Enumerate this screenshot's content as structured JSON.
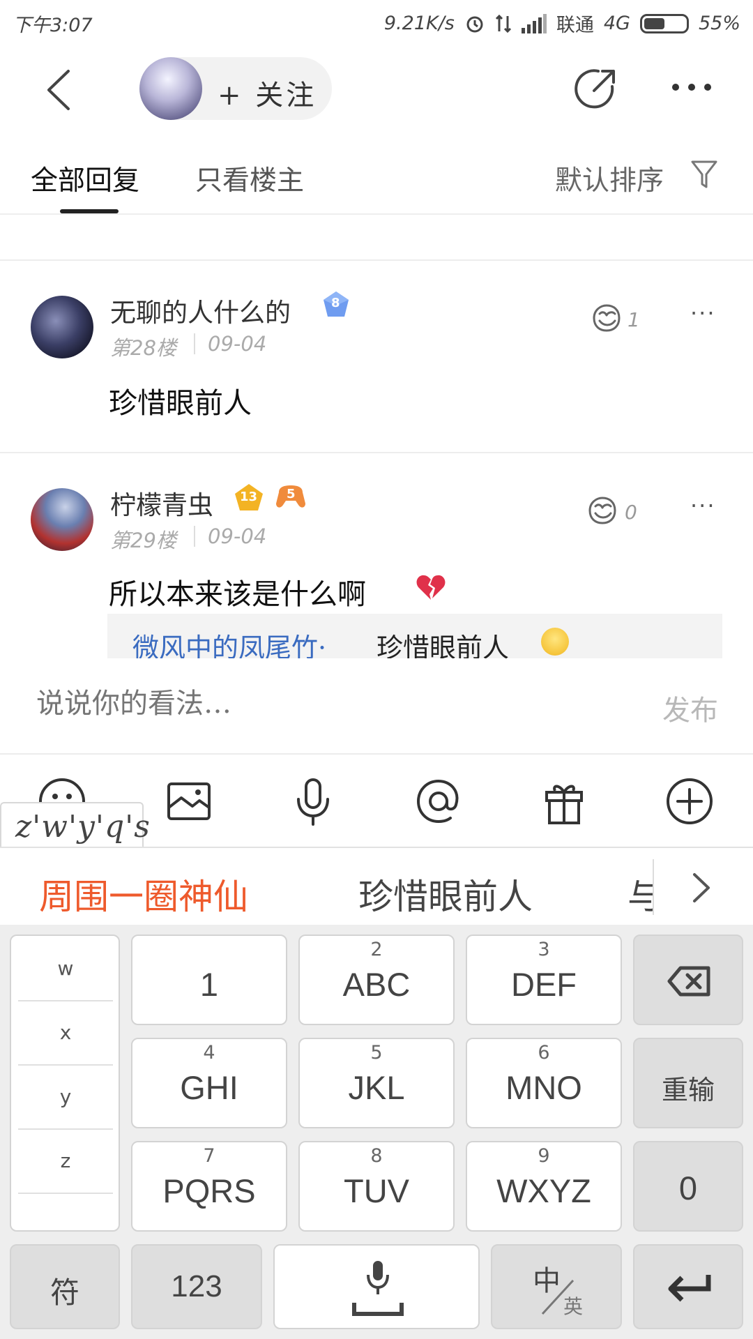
{
  "status_bar": {
    "time": "下午3:07",
    "speed": "9.21K/s",
    "carrier": "联通",
    "network": "4G",
    "battery_percent": "55%",
    "battery_level": 0.55
  },
  "header": {
    "follow_label": "+ 关注"
  },
  "tabs": {
    "all_replies": "全部回复",
    "owner_only": "只看楼主",
    "sort": "默认排序"
  },
  "posts": [
    {
      "username": "无聊的人什么的",
      "level": "8",
      "floor": "第28楼",
      "date": "09-04",
      "content": "珍惜眼前人",
      "likes": "1"
    },
    {
      "username": "柠檬青虫",
      "level": "13",
      "badge2": "5",
      "floor": "第29楼",
      "date": "09-04",
      "content": "所以本来该是什么啊",
      "likes": "0",
      "reply": {
        "name": "微风中的凤尾竹·",
        "text": "珍惜眼前人"
      }
    }
  ],
  "composer": {
    "placeholder": "说说你的看法…",
    "publish": "发布"
  },
  "toolbar": {
    "icons": [
      "emoji-icon",
      "image-icon",
      "microphone-icon",
      "at-icon",
      "gift-icon",
      "plus-icon"
    ]
  },
  "ime": {
    "pinyin": "z'w'y'q's",
    "candidates": [
      "周围一圈神仙",
      "珍惜眼前人",
      "与"
    ],
    "side_letters": [
      "w",
      "x",
      "y",
      "z"
    ],
    "keys": {
      "k1": {
        "num": "",
        "label": "1"
      },
      "k2": {
        "num": "2",
        "label": "ABC"
      },
      "k3": {
        "num": "3",
        "label": "DEF"
      },
      "k4": {
        "num": "4",
        "label": "GHI"
      },
      "k5": {
        "num": "5",
        "label": "JKL"
      },
      "k6": {
        "num": "6",
        "label": "MNO"
      },
      "k7": {
        "num": "7",
        "label": "PQRS"
      },
      "k8": {
        "num": "8",
        "label": "TUV"
      },
      "k9": {
        "num": "9",
        "label": "WXYZ"
      },
      "reset": "重输",
      "zero": "0",
      "symbol": "符",
      "numeric": "123",
      "lang_zh": "中",
      "lang_en": "英"
    }
  }
}
